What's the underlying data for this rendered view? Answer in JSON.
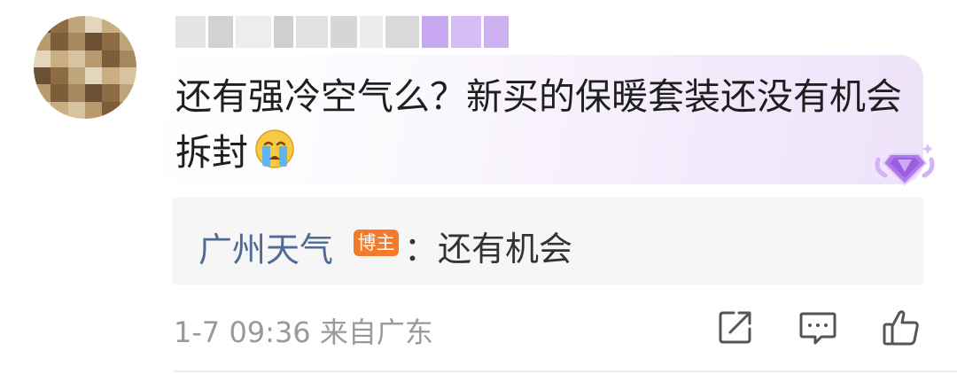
{
  "user": {
    "avatar": "avatar-image",
    "username_pixels": [
      "#e5e5e5",
      "#d2d2d2",
      "#ededed",
      "#cfcfcf",
      "#e1e1e1",
      "#d6d6d6",
      "#ebebeb",
      "#d9d9d9",
      "#c8a8f0",
      "#d7bdf5",
      "#cdb1f2"
    ]
  },
  "comment": {
    "text": "还有强冷空气么？新买的保暖套装还没有机会拆封",
    "emoji": "crying-face"
  },
  "reply": {
    "author": "广州天气",
    "tag": "博主",
    "text": "：还有机会"
  },
  "meta": {
    "time_location": "1-7 09:36 来自广东"
  },
  "icons": {
    "share": "share-icon",
    "comment": "comment-icon",
    "like": "like-icon",
    "badge": "diamond-badge-icon"
  },
  "colors": {
    "reply_author": "#4f6a96",
    "tag_bg": "#f47a2a",
    "meta_text": "#9a9a9a",
    "bubble_accent": "#eee3fa"
  }
}
